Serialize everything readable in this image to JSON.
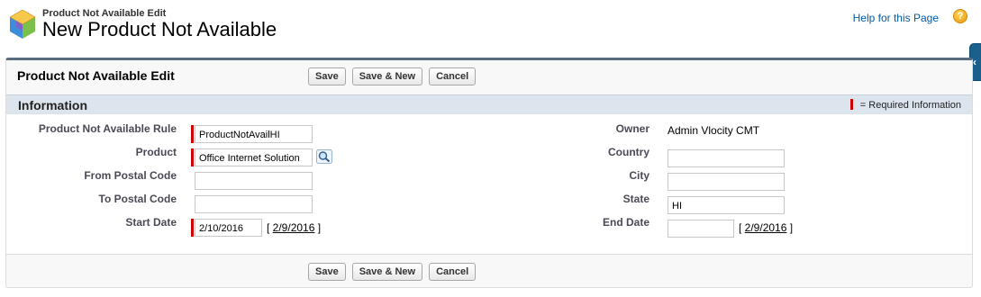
{
  "header": {
    "page_type": "Product Not Available Edit",
    "page_title": "New Product Not Available",
    "help_link": "Help for this Page",
    "help_icon": "?"
  },
  "side_tab": {
    "glyph": "‹"
  },
  "block": {
    "title": "Product Not Available Edit",
    "buttons": {
      "save": "Save",
      "save_new": "Save & New",
      "cancel": "Cancel"
    }
  },
  "section": {
    "title": "Information",
    "required_legend": "= Required Information"
  },
  "fields": {
    "rule": {
      "label": "Product Not Available Rule",
      "value": "ProductNotAvailHI",
      "required": true
    },
    "product": {
      "label": "Product",
      "value": "Office Internet Solution",
      "required": true
    },
    "from_postal": {
      "label": "From Postal Code",
      "value": ""
    },
    "to_postal": {
      "label": "To Postal Code",
      "value": ""
    },
    "start_date": {
      "label": "Start Date",
      "value": "2/10/2016",
      "today_open": "[ ",
      "today": "2/9/2016",
      "today_close": " ]",
      "required": true
    },
    "owner": {
      "label": "Owner",
      "value": "Admin Vlocity CMT"
    },
    "country": {
      "label": "Country",
      "value": ""
    },
    "city": {
      "label": "City",
      "value": ""
    },
    "state": {
      "label": "State",
      "value": "HI"
    },
    "end_date": {
      "label": "End Date",
      "value": "",
      "today_open": "[ ",
      "today": "2/9/2016",
      "today_close": " ]"
    }
  },
  "colors": {
    "required": "#cc0000",
    "section_bg": "#dce5ee",
    "link": "#015ba7"
  }
}
